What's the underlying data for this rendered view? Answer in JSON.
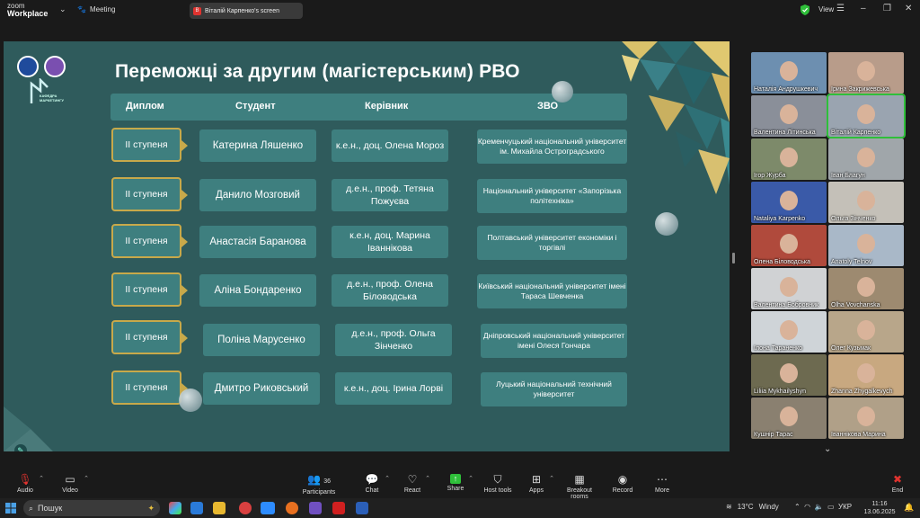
{
  "app": {
    "logo_line1": "zoom",
    "logo_line2": "Workplace",
    "meeting_label": "Meeting",
    "share_label": "Віталій Карпенко's screen",
    "view_label": "View"
  },
  "slide": {
    "title": "Переможці за другим (магістерським) РВО",
    "dept_label": "КАФЕДРА МАРКЕТИНГУ",
    "headers": {
      "diploma": "Диплом",
      "student": "Студент",
      "supervisor": "Керівник",
      "university": "ЗВО"
    },
    "rows": [
      {
        "diploma": "ІІ ступеня",
        "student": "Катерина Ляшенко",
        "supervisor": "к.е.н., доц. Олена Мороз",
        "university": "Кременчуцький національний університет ім. Михайла Остроградського"
      },
      {
        "diploma": "ІІ ступеня",
        "student": "Данило Мозговий",
        "supervisor": "д.е.н., проф. Тетяна Пожуєва",
        "university": "Національний університет «Запорізька політехніка»"
      },
      {
        "diploma": "ІІ ступеня",
        "student": "Анастасія Баранова",
        "supervisor": "к.е.н, доц. Марина Іваннікова",
        "university": "Полтавський університет економіки і торгівлі"
      },
      {
        "diploma": "ІІ ступеня",
        "student": "Аліна Бондаренко",
        "supervisor": "д.е.н., проф. Олена Біловодська",
        "university": "Київський національний університет імені Тараса Шевченка"
      },
      {
        "diploma": "ІІ ступеня",
        "student": "Поліна Марусенко",
        "supervisor": "д.е.н., проф. Ольга Зінченко",
        "university": "Дніпровський національний університет імені Олеся Гончара"
      },
      {
        "diploma": "ІІ ступеня",
        "student": "Дмитро Риковський",
        "supervisor": "к.е.н., доц. Ірина Лорві",
        "university": "Луцький національний технічний університет"
      }
    ]
  },
  "participants": [
    {
      "name": "Наталія Андрушкевич",
      "bg": "#6d8fb0"
    },
    {
      "name": "Ірина Закрижевська",
      "bg": "#b89c8a"
    },
    {
      "name": "Валентина Літинська",
      "bg": "#8a8f99"
    },
    {
      "name": "Віталій Карпенко",
      "bg": "#9aa4b0"
    },
    {
      "name": "Ігор Журба",
      "bg": "#7d8a6a"
    },
    {
      "name": "Іван Благун",
      "bg": "#a0a6aa"
    },
    {
      "name": "Nataliya Karpenko",
      "bg": "#3a5aa8"
    },
    {
      "name": "Ольга Зінченко",
      "bg": "#c4c0b8"
    },
    {
      "name": "Олена Біловодська",
      "bg": "#b04a3c"
    },
    {
      "name": "Anatoly Telnov",
      "bg": "#a9b8c8"
    },
    {
      "name": "Валентина Бобровник",
      "bg": "#d0d2d4"
    },
    {
      "name": "Olha Vovchanska",
      "bg": "#9d8a70"
    },
    {
      "name": "Ілона Тараненко",
      "bg": "#cfd4d8"
    },
    {
      "name": "Олег Кузьмак",
      "bg": "#b8a68a"
    },
    {
      "name": "Liliia Mykhailyshyn",
      "bg": "#6d6a50"
    },
    {
      "name": "Zhanna Zhygalkevych",
      "bg": "#c8a880"
    },
    {
      "name": "Кушнір Тарас",
      "bg": "#8a8070"
    },
    {
      "name": "Іваннікова Марина",
      "bg": "#b0a088"
    }
  ],
  "toolbar": {
    "audio": "Audio",
    "video": "Video",
    "participants": "Participants",
    "participants_count": "36",
    "chat": "Chat",
    "react": "React",
    "share": "Share",
    "host_tools": "Host tools",
    "apps": "Apps",
    "breakout": "Breakout rooms",
    "record": "Record",
    "more": "More",
    "end": "End"
  },
  "taskbar": {
    "search_placeholder": "Пошук",
    "temp": "13°C",
    "weather": "Windy",
    "lang": "УКР",
    "time": "11:16",
    "date": "13.06.2025"
  },
  "colors": {
    "slide_bg": "#2f5b5c",
    "cell_bg": "#3e7f7f",
    "gold": "#c8a94a",
    "active_outline": "#2fbf3a",
    "end_red": "#e0332f"
  }
}
